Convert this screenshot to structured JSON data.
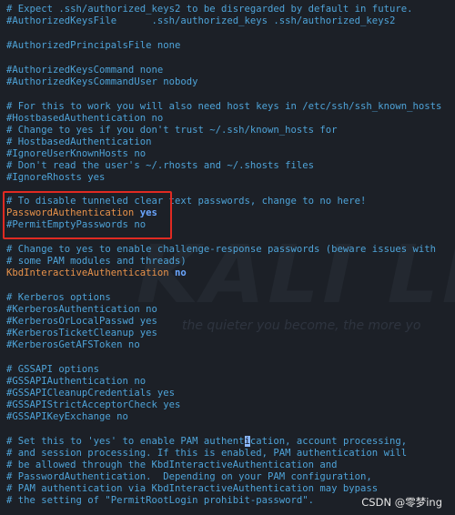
{
  "terminal": {
    "lines": [
      "# Expect .ssh/authorized_keys2 to be disregarded by default in future.",
      "#AuthorizedKeysFile      .ssh/authorized_keys .ssh/authorized_keys2",
      "#AuthorizedPrincipalsFile none",
      "#AuthorizedKeysCommand none",
      "#AuthorizedKeysCommandUser nobody",
      "# For this to work you will also need host keys in /etc/ssh/ssh_known_hosts",
      "#HostbasedAuthentication no",
      "# Change to yes if you don't trust ~/.ssh/known_hosts for",
      "# HostbasedAuthentication",
      "#IgnoreUserKnownHosts no",
      "# Don't read the user's ~/.rhosts and ~/.shosts files",
      "#IgnoreRhosts yes",
      "# To disable tunneled clear text passwords, change to no here!",
      "#PermitEmptyPasswords no",
      "# Change to yes to enable challenge-response passwords (beware issues with",
      "# some PAM modules and threads)",
      "# Kerberos options",
      "#KerberosAuthentication no",
      "#KerberosOrLocalPasswd yes",
      "#KerberosTicketCleanup yes",
      "#KerberosGetAFSToken no",
      "# GSSAPI options",
      "#GSSAPIAuthentication no",
      "#GSSAPICleanupCredentials yes",
      "#GSSAPIStrictAcceptorCheck yes",
      "#GSSAPIKeyExchange no",
      "# and session processing. If this is enabled, PAM authentication will",
      "# be allowed through the KbdInteractiveAuthentication and",
      "# PasswordAuthentication.  Depending on your PAM configuration,",
      "# PAM authentication via KbdInteractiveAuthentication may bypass",
      "# the setting of \"PermitRootLogin prohibit-password\"."
    ],
    "password_auth_key": "PasswordAuthentication",
    "password_auth_value": "yes",
    "kbd_auth_key": "KbdInteractiveAuthentication",
    "kbd_auth_value": "no",
    "pam_line_before_cursor": "# Set this to 'yes' to enable PAM authent",
    "pam_line_cursor_char": "i",
    "pam_line_after_cursor": "cation, account processing,"
  },
  "watermark": {
    "text": "KALI LI",
    "motto": "the quieter you become, the more yo"
  },
  "footer": {
    "credit": "CSDN @零梦ing"
  },
  "colors": {
    "background": "#1c2027",
    "comment": "#4ea3d8",
    "keyword": "#e8924a",
    "value": "#6aa6ff",
    "highlight_border": "#e02a22"
  }
}
